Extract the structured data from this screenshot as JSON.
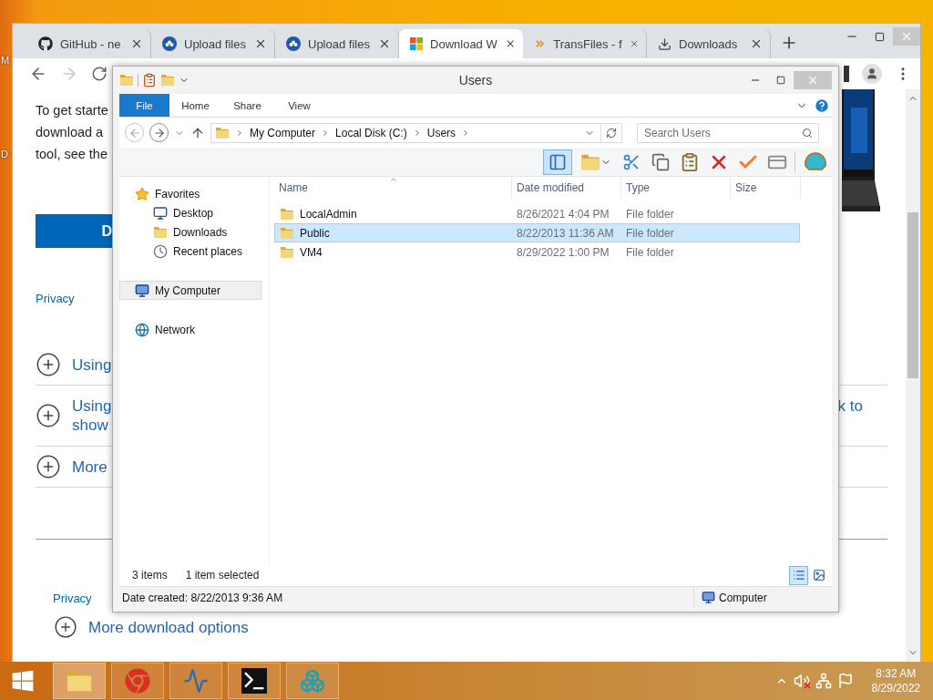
{
  "desktop": {
    "icon_labels": [
      "M",
      "D"
    ]
  },
  "browser": {
    "tabs": [
      {
        "label": "GitHub - ne",
        "kind": "cat",
        "selected": false
      },
      {
        "label": "Upload files",
        "kind": "cloud",
        "selected": false
      },
      {
        "label": "Upload files",
        "kind": "cloud",
        "selected": false
      },
      {
        "label": "Download W",
        "kind": "squares",
        "selected": true
      },
      {
        "label": "TransFiles - f",
        "kind": "chevrons",
        "selected": false
      },
      {
        "label": "Downloads",
        "kind": "download",
        "selected": false
      }
    ],
    "nav_buttons": [
      {
        "kind": "back",
        "disabled": false
      },
      {
        "kind": "forward",
        "disabled": true
      },
      {
        "kind": "reload",
        "disabled": false
      }
    ],
    "page": {
      "intro_lines": [
        "To get starte",
        "download a",
        "tool, see the"
      ],
      "button_label": "D",
      "privacy_top": "Privacy",
      "sections": [
        {
          "lines": [
            "Using"
          ]
        },
        {
          "lines": [
            "Using",
            "show"
          ],
          "right_text": "k to"
        },
        {
          "lines": [
            "More"
          ]
        }
      ],
      "privacy_bottom": "Privacy",
      "more_options": "More download options"
    }
  },
  "explorer": {
    "title": "Users",
    "ribbon_tabs": [
      {
        "label": "File",
        "kind": "menu"
      },
      {
        "label": "Home",
        "kind": "tab"
      },
      {
        "label": "Share",
        "kind": "tab"
      },
      {
        "label": "View",
        "kind": "tab"
      }
    ],
    "address": {
      "crumbs": [
        "My Computer",
        "Local Disk (C:)",
        "Users"
      ]
    },
    "search": {
      "placeholder": "Search Users"
    },
    "commands": [
      {
        "kind": "preview-pane",
        "on": true
      },
      {
        "kind": "folder-options",
        "on": false
      },
      {
        "kind": "cut",
        "on": false
      },
      {
        "kind": "copy",
        "on": false
      },
      {
        "kind": "paste",
        "on": false
      },
      {
        "kind": "delete",
        "on": false
      },
      {
        "kind": "check",
        "on": false
      },
      {
        "kind": "rename",
        "on": false
      },
      {
        "kind": "shell",
        "on": false
      }
    ],
    "nav_pane": [
      {
        "label": "Favorites",
        "kind": "star",
        "selected": false,
        "children": [
          {
            "label": "Desktop",
            "kind": "desktop",
            "selected": false
          },
          {
            "label": "Downloads",
            "kind": "downloads",
            "selected": false
          },
          {
            "label": "Recent places",
            "kind": "recent",
            "selected": false
          }
        ]
      },
      {
        "label": "My Computer",
        "kind": "computer",
        "selected": true
      },
      {
        "label": "Network",
        "kind": "network",
        "selected": false
      }
    ],
    "columns": [
      "Name",
      "Date modified",
      "Type",
      "Size"
    ],
    "files": [
      {
        "name": "LocalAdmin",
        "date_modified": "8/26/2021 4:04 PM",
        "type": "File folder",
        "selected": false
      },
      {
        "name": "Public",
        "date_modified": "8/22/2013 11:36 AM",
        "type": "File folder",
        "selected": true
      },
      {
        "name": "VM4",
        "date_modified": "8/29/2022 1:00 PM",
        "type": "File folder",
        "selected": false
      }
    ],
    "status": {
      "item_count": "3 items",
      "selection": "1 item selected"
    },
    "view_buttons": [
      {
        "kind": "details",
        "selected": true
      },
      {
        "kind": "large-icons",
        "selected": false
      }
    ],
    "details_bar": {
      "date_created": "Date created: 8/22/2013 9:36 AM",
      "location": "Computer"
    }
  },
  "taskbar": {
    "apps": [
      {
        "kind": "explorer",
        "selected": true
      },
      {
        "kind": "browser",
        "selected": false
      },
      {
        "kind": "monitor",
        "selected": false
      },
      {
        "kind": "console",
        "selected": false
      },
      {
        "kind": "cubes",
        "selected": false
      }
    ],
    "tray": {
      "volume_muted": true
    },
    "clock": {
      "time": "8:32 AM",
      "date": "8/29/2022"
    }
  }
}
